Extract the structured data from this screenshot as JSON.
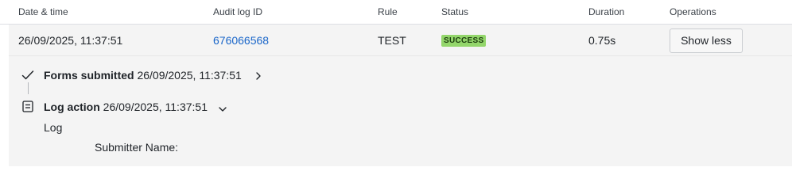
{
  "table": {
    "columns": [
      "Date & time",
      "Audit log ID",
      "Rule",
      "Status",
      "Duration",
      "Operations"
    ],
    "row": {
      "datetime": "26/09/2025, 11:37:51",
      "audit_id": "676066568",
      "rule": "TEST",
      "status": "SUCCESS",
      "duration": "0.75s",
      "operation_label": "Show less"
    }
  },
  "steps": [
    {
      "title": "Forms submitted",
      "time": "26/09/2025, 11:37:51",
      "icon": "check-icon",
      "toggle_icon": "chevron-right-icon"
    },
    {
      "title": "Log action",
      "time": "26/09/2025, 11:37:51",
      "icon": "document-icon",
      "toggle_icon": "chevron-down-icon"
    }
  ],
  "log_detail": {
    "label": "Log",
    "field_label": "Submitter Name:"
  },
  "colors": {
    "link": "#1a66c9",
    "success_badge": "#93d66b",
    "expanded_bg": "#f4f4f4"
  }
}
